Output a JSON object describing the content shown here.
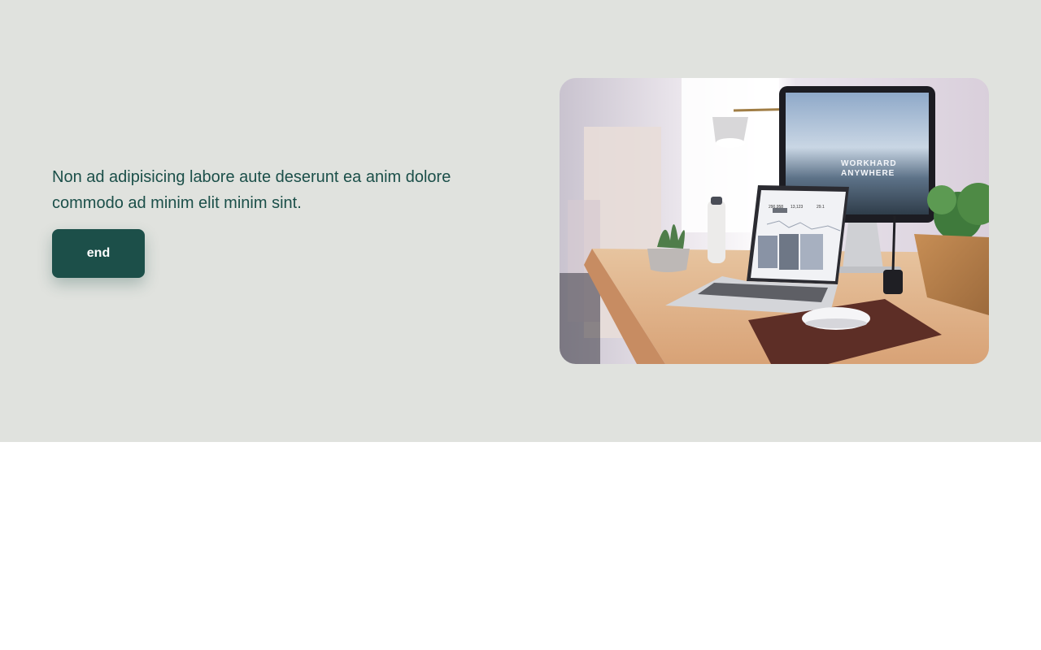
{
  "hero": {
    "text": "Non ad adipisicing labore aute deserunt ea anim dolore commodo ad minim elit minim sint.",
    "button_label": "end",
    "background_color": "#e0e2de",
    "accent_color": "#1c4f49"
  },
  "photo": {
    "monitor_line1": "WORKHARD",
    "monitor_line2": "ANYWHERE",
    "laptop_stat1": "290,958",
    "laptop_stat2": "13,123",
    "laptop_stat3": "29.1"
  }
}
